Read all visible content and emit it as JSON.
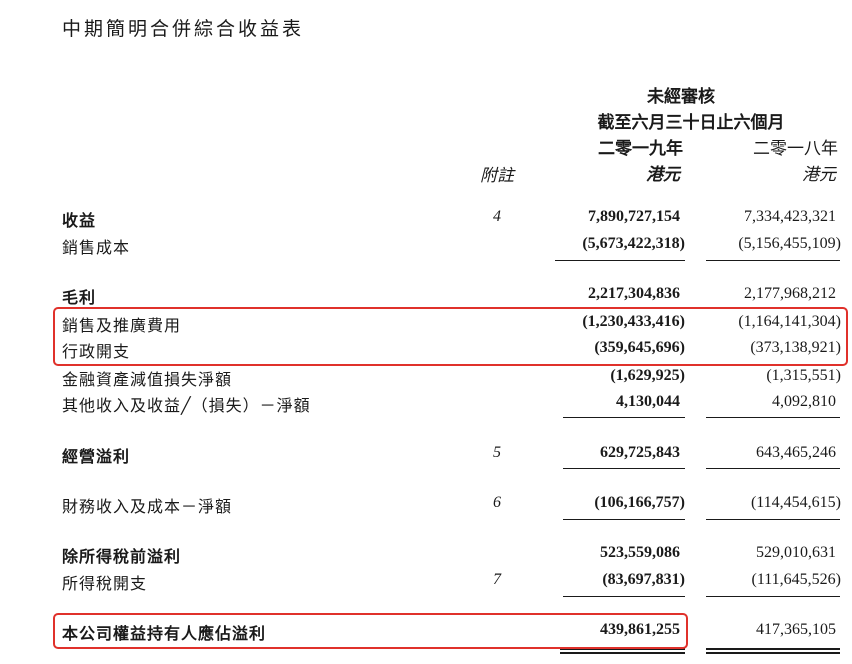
{
  "title": "中期簡明合併綜合收益表",
  "header": {
    "unaudited": "未經審核",
    "period": "截至六月三十日止六個月",
    "col_current": "二零一九年",
    "col_prior": "二零一八年",
    "note_header": "附註",
    "currency_current": "港元",
    "currency_prior": "港元"
  },
  "rows": [
    {
      "label": "收益",
      "note": "4",
      "current": "7,890,727,154",
      "prior": "7,334,423,321"
    },
    {
      "label": "銷售成本",
      "note": "",
      "current": "(5,673,422,318)",
      "prior": "(5,156,455,109)"
    },
    {
      "label": "毛利",
      "note": "",
      "current": "2,217,304,836",
      "prior": "2,177,968,212"
    },
    {
      "label": "銷售及推廣費用",
      "note": "",
      "current": "(1,230,433,416)",
      "prior": "(1,164,141,304)"
    },
    {
      "label": "行政開支",
      "note": "",
      "current": "(359,645,696)",
      "prior": "(373,138,921)"
    },
    {
      "label": "金融資產減值損失淨額",
      "note": "",
      "current": "(1,629,925)",
      "prior": "(1,315,551)"
    },
    {
      "label": "其他收入及收益╱（損失）－淨額",
      "note": "",
      "current": "4,130,044",
      "prior": "4,092,810"
    },
    {
      "label": "經營溢利",
      "note": "5",
      "current": "629,725,843",
      "prior": "643,465,246"
    },
    {
      "label": "財務收入及成本－淨額",
      "note": "6",
      "current": "(106,166,757)",
      "prior": "(114,454,615)"
    },
    {
      "label": "除所得稅前溢利",
      "note": "",
      "current": "523,559,086",
      "prior": "529,010,631"
    },
    {
      "label": "所得稅開支",
      "note": "7",
      "current": "(83,697,831)",
      "prior": "(111,645,526)"
    },
    {
      "label": "本公司權益持有人應佔溢利",
      "note": "",
      "current": "439,861,255",
      "prior": "417,365,105"
    }
  ],
  "highlight_color": "#e0312b"
}
